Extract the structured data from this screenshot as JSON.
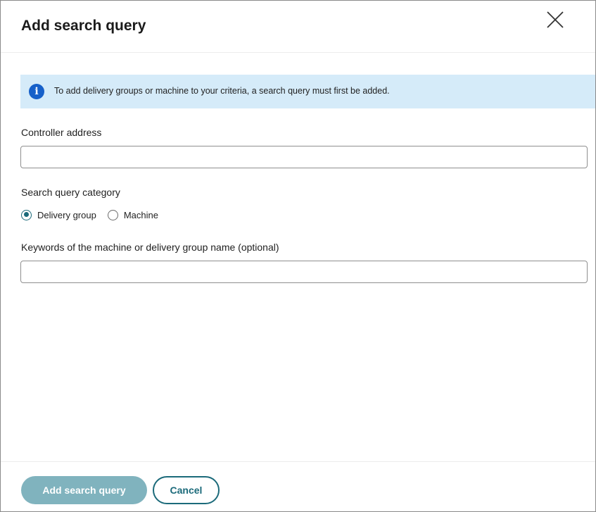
{
  "dialog": {
    "title": "Add search query",
    "close_icon": "close-icon"
  },
  "info_banner": {
    "icon": "info-icon",
    "icon_glyph": "i",
    "text": "To add delivery groups or machine to your criteria, a search query must first be added."
  },
  "form": {
    "controller_address": {
      "label": "Controller address",
      "value": ""
    },
    "category": {
      "label": "Search query category",
      "options": [
        {
          "label": "Delivery group",
          "selected": true
        },
        {
          "label": "Machine",
          "selected": false
        }
      ]
    },
    "keywords": {
      "label": "Keywords of the machine or delivery group name (optional)",
      "value": ""
    }
  },
  "footer": {
    "primary_label": "Add search query",
    "secondary_label": "Cancel"
  },
  "colors": {
    "accent": "#1b6a7a",
    "primary_disabled": "#80b3be",
    "info_background": "#d5ebf9",
    "info_icon": "#1660c9"
  }
}
